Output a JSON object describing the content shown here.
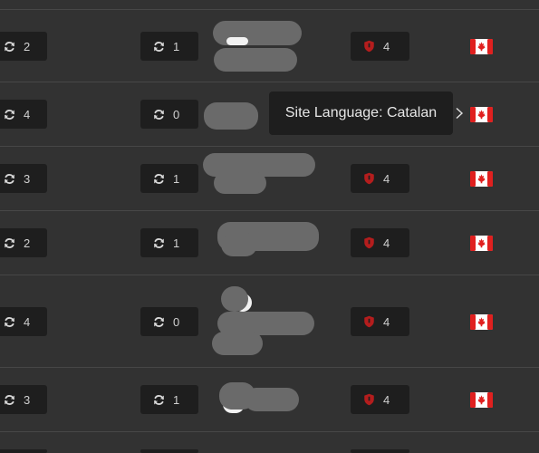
{
  "icons": {
    "sync": "sync-icon",
    "shield": "shield-icon",
    "flag": "canada-flag-icon"
  },
  "colors": {
    "background": "#323232",
    "pill": "#1e1e1e",
    "shield_red": "#b41d1d",
    "flag_red": "#e0201f"
  },
  "tooltip": {
    "text": "Site Language: Catalan"
  },
  "rows": [
    {
      "sync_a": "2",
      "sync_b": "1",
      "shield": "4",
      "has_shield": true
    },
    {
      "sync_a": "4",
      "sync_b": "0",
      "shield": "",
      "has_shield": false
    },
    {
      "sync_a": "3",
      "sync_b": "1",
      "shield": "4",
      "has_shield": true
    },
    {
      "sync_a": "2",
      "sync_b": "1",
      "shield": "4",
      "has_shield": true
    },
    {
      "sync_a": "4",
      "sync_b": "0",
      "shield": "4",
      "has_shield": true
    },
    {
      "sync_a": "3",
      "sync_b": "1",
      "shield": "4",
      "has_shield": true
    }
  ]
}
